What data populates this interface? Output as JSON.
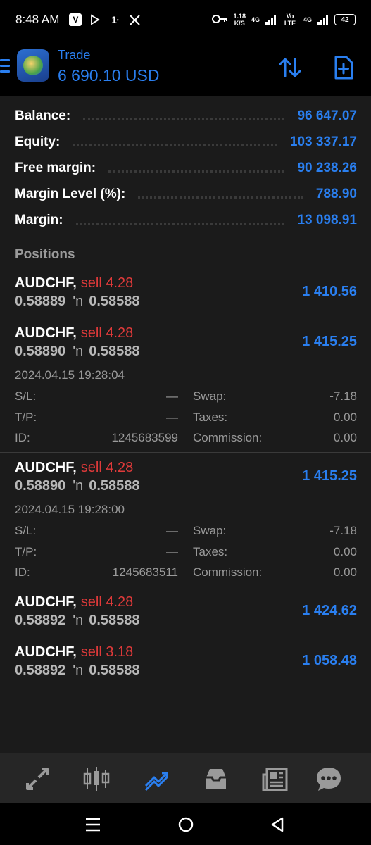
{
  "status_bar": {
    "time": "8:48 AM",
    "icons_left": [
      "v-icon",
      "play-icon",
      "notification-count-icon",
      "x-icon"
    ],
    "notification_count": "1",
    "speed_value": "1.18",
    "speed_unit": "K/S",
    "network_1": "4G",
    "volte": "Vo LTE",
    "network_2": "4G",
    "battery": "42"
  },
  "header": {
    "title": "Trade",
    "balance": "6 690.10 USD"
  },
  "summary": [
    {
      "label": "Balance:",
      "value": "96 647.07"
    },
    {
      "label": "Equity:",
      "value": "103 337.17"
    },
    {
      "label": "Free margin:",
      "value": "90 238.26"
    },
    {
      "label": "Margin Level (%):",
      "value": "788.90"
    },
    {
      "label": "Margin:",
      "value": "13 098.91"
    }
  ],
  "positions_title": "Positions",
  "positions": [
    {
      "symbol": "AUDCHF,",
      "side": "sell 4.28",
      "open_price": "0.58889",
      "current_price": "0.58588",
      "profit": "1 410.56"
    },
    {
      "symbol": "AUDCHF,",
      "side": "sell 4.28",
      "open_price": "0.58890",
      "current_price": "0.58588",
      "profit": "1 415.25",
      "date": "2024.04.15 19:28:04",
      "sl_label": "S/L:",
      "sl": "—",
      "tp_label": "T/P:",
      "tp": "—",
      "id_label": "ID:",
      "id": "1245683599",
      "swap_label": "Swap:",
      "swap": "-7.18",
      "taxes_label": "Taxes:",
      "taxes": "0.00",
      "commission_label": "Commission:",
      "commission": "0.00"
    },
    {
      "symbol": "AUDCHF,",
      "side": "sell 4.28",
      "open_price": "0.58890",
      "current_price": "0.58588",
      "profit": "1 415.25",
      "date": "2024.04.15 19:28:00",
      "sl_label": "S/L:",
      "sl": "—",
      "tp_label": "T/P:",
      "tp": "—",
      "id_label": "ID:",
      "id": "1245683511",
      "swap_label": "Swap:",
      "swap": "-7.18",
      "taxes_label": "Taxes:",
      "taxes": "0.00",
      "commission_label": "Commission:",
      "commission": "0.00"
    },
    {
      "symbol": "AUDCHF,",
      "side": "sell 4.28",
      "open_price": "0.58892",
      "current_price": "0.58588",
      "profit": "1 424.62"
    },
    {
      "symbol": "AUDCHF,",
      "side": "sell 3.18",
      "open_price": "0.58892",
      "current_price": "0.58588",
      "profit": "1 058.48"
    }
  ],
  "price_arrow": "'n",
  "bottom_nav": [
    "quotes-icon",
    "chart-icon",
    "trade-icon",
    "history-icon",
    "news-icon",
    "chat-icon"
  ],
  "colors": {
    "accent": "#2a7ff0",
    "sell": "#e03a3a",
    "panel": "#1b1b1b",
    "nav": "#262626"
  }
}
